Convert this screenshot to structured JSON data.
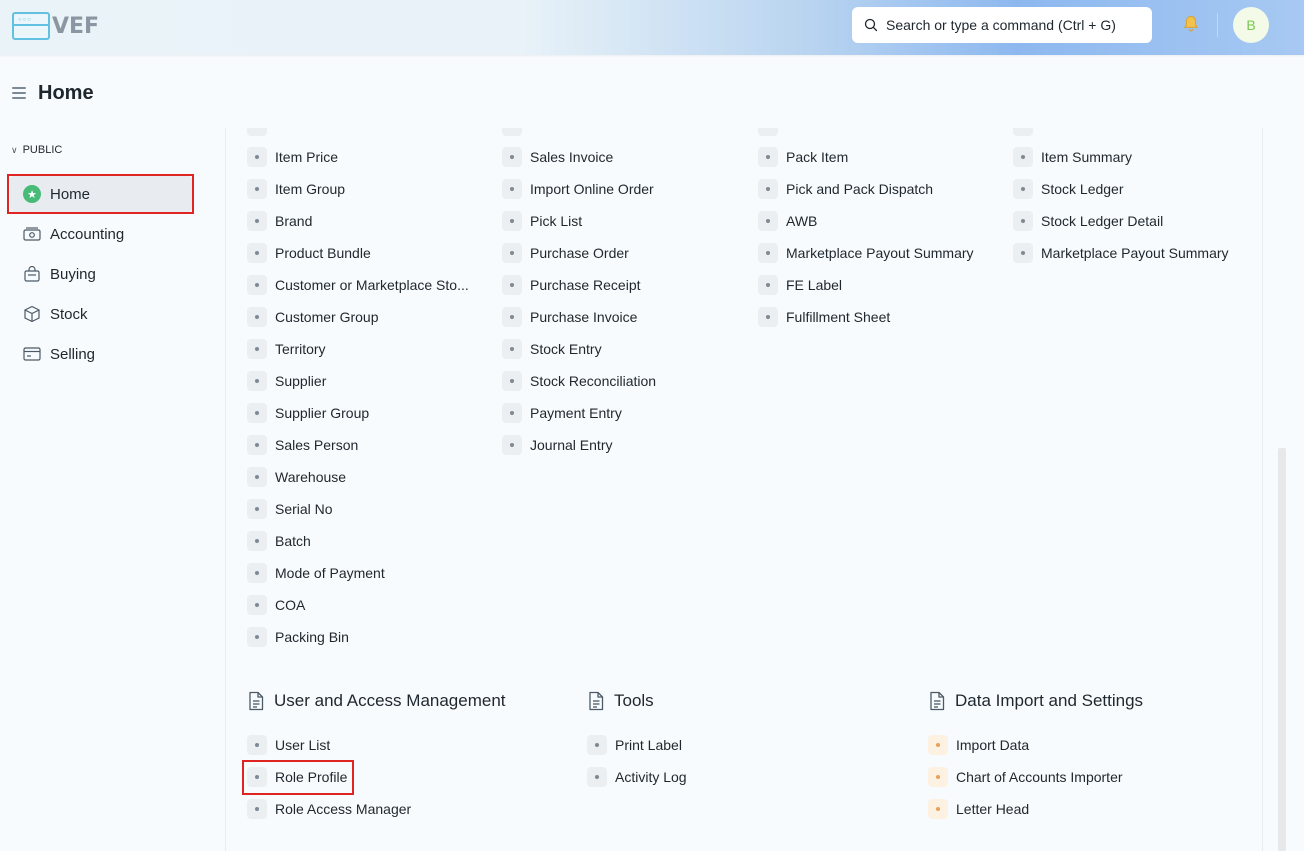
{
  "app": {
    "logo_text": "VEF"
  },
  "navbar": {
    "search_placeholder": "Search or type a command (Ctrl + G)",
    "avatar_initial": "B",
    "icons": [
      "search-icon",
      "bell-icon"
    ]
  },
  "page": {
    "title": "Home"
  },
  "sidebar": {
    "section_label": "PUBLIC",
    "items": [
      {
        "label": "Home",
        "icon": "star-icon",
        "active": true
      },
      {
        "label": "Accounting",
        "icon": "money-icon"
      },
      {
        "label": "Buying",
        "icon": "basket-icon"
      },
      {
        "label": "Stock",
        "icon": "box-icon"
      },
      {
        "label": "Selling",
        "icon": "card-icon"
      }
    ]
  },
  "cards": {
    "col1": [
      "Item Price",
      "Item Group",
      "Brand",
      "Product Bundle",
      "Customer or Marketplace Sto...",
      "Customer Group",
      "Territory",
      "Supplier",
      "Supplier Group",
      "Sales Person",
      "Warehouse",
      "Serial No",
      "Batch",
      "Mode of Payment",
      "COA",
      "Packing Bin"
    ],
    "col2": [
      "Sales Invoice",
      "Import Online Order",
      "Pick List",
      "Purchase Order",
      "Purchase Receipt",
      "Purchase Invoice",
      "Stock Entry",
      "Stock Reconciliation",
      "Payment Entry",
      "Journal Entry"
    ],
    "col3": [
      "Pack Item",
      "Pick and Pack Dispatch",
      "AWB",
      "Marketplace Payout Summary",
      "FE Label",
      "Fulfillment Sheet"
    ],
    "col4": [
      "Item Summary",
      "Stock Ledger",
      "Stock Ledger Detail",
      "Marketplace Payout Summary"
    ]
  },
  "sections": [
    {
      "title": "User and Access Management",
      "links": [
        "User List",
        "Role Profile",
        "Role Access Manager"
      ]
    },
    {
      "title": "Tools",
      "links": [
        "Print Label",
        "Activity Log"
      ]
    },
    {
      "title": "Data Import and Settings",
      "links": [
        "Import Data",
        "Chart of Accounts Importer",
        "Letter Head"
      ]
    }
  ],
  "colors": {
    "accent_green": "#48bb78",
    "highlight_red": "#e02424",
    "bullet_orange": "#e8a05b"
  }
}
